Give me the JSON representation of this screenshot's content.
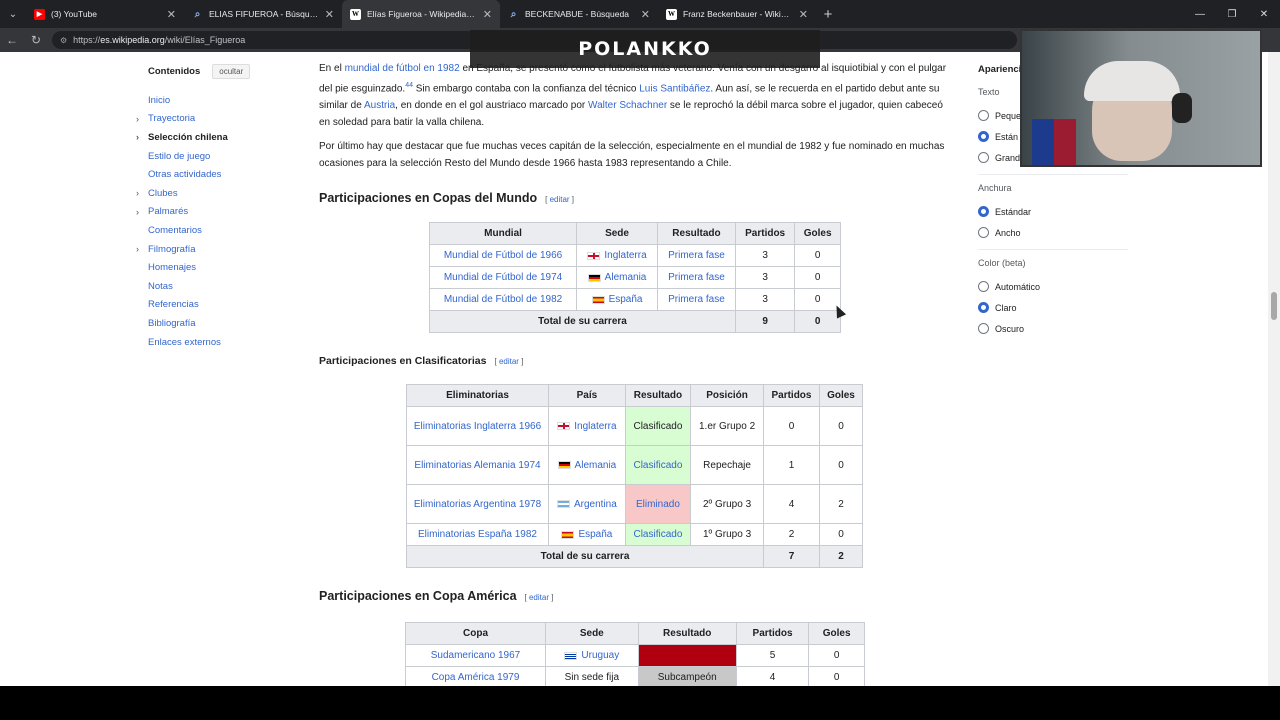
{
  "browser": {
    "tabs": [
      {
        "label": "(3) YouTube",
        "icon": "youtube-icon",
        "active": false
      },
      {
        "label": "ELIAS FIFUEROA - Búsqueda",
        "icon": "search-icon",
        "active": false
      },
      {
        "label": "Elías Figueroa - Wikipedia, la encic",
        "icon": "wikipedia-icon",
        "active": true
      },
      {
        "label": "BECKENABUE - Búsqueda",
        "icon": "search-icon",
        "active": false
      },
      {
        "label": "Franz Beckenbauer - Wikipedia, la",
        "icon": "wikipedia-icon",
        "active": false
      }
    ],
    "url_prefix": "https://",
    "url_domain": "es.wikipedia.org",
    "url_path": "/wiki/Elías_Figueroa"
  },
  "overlay": {
    "logo_text": "POLANKKO"
  },
  "toc": {
    "title": "Contenidos",
    "hide_label": "ocultar",
    "items": [
      {
        "label": "Inicio",
        "chevron": false,
        "active": false
      },
      {
        "label": "Trayectoria",
        "chevron": true,
        "active": false
      },
      {
        "label": "Selección chilena",
        "chevron": true,
        "active": true
      },
      {
        "label": "Estilo de juego",
        "chevron": false,
        "active": false
      },
      {
        "label": "Otras actividades",
        "chevron": false,
        "active": false
      },
      {
        "label": "Clubes",
        "chevron": true,
        "active": false
      },
      {
        "label": "Palmarés",
        "chevron": true,
        "active": false
      },
      {
        "label": "Comentarios",
        "chevron": false,
        "active": false
      },
      {
        "label": "Filmografía",
        "chevron": true,
        "active": false
      },
      {
        "label": "Homenajes",
        "chevron": false,
        "active": false
      },
      {
        "label": "Notas",
        "chevron": false,
        "active": false
      },
      {
        "label": "Referencias",
        "chevron": false,
        "active": false
      },
      {
        "label": "Bibliografía",
        "chevron": false,
        "active": false
      },
      {
        "label": "Enlaces externos",
        "chevron": false,
        "active": false
      }
    ]
  },
  "article": {
    "p1": {
      "a": "En el ",
      "link1": "mundial de fútbol en 1982",
      "b": " en España, se presentó como el futbolista más veterano. Venía con un desgarro al isquiotibial y con el pulgar del pie esguinzado.",
      "sup": "44",
      "c": " Sin embargo contaba con la confianza del técnico ",
      "link2": "Luis Santibáñez",
      "d": ". Aun así, se le recuerda en el partido debut ante su similar de ",
      "link3": "Austria",
      "e": ", en donde en el gol austriaco marcado por ",
      "link4": "Walter Schachner",
      "f": " se le reprochó la débil marca sobre el jugador, quien cabeceó en soledad para batir la valla chilena."
    },
    "p2": "Por último hay que destacar que fue muchas veces capitán de la selección, especialmente en el mundial de 1982 y fue nominado en muchas ocasiones para la selección Resto del Mundo desde 1966 hasta 1983 representando a Chile.",
    "edit_label": "editar",
    "wc": {
      "heading": "Participaciones en Copas del Mundo",
      "headers": [
        "Mundial",
        "Sede",
        "Resultado",
        "Partidos",
        "Goles"
      ],
      "rows": [
        {
          "mundial": "Mundial de Fútbol de 1966",
          "flag": "eng",
          "sede": "Inglaterra",
          "resultado": "Primera fase",
          "partidos": "3",
          "goles": "0"
        },
        {
          "mundial": "Mundial de Fútbol de 1974",
          "flag": "de",
          "sede": "Alemania",
          "resultado": "Primera fase",
          "partidos": "3",
          "goles": "0"
        },
        {
          "mundial": "Mundial de Fútbol de 1982",
          "flag": "es",
          "sede": "España",
          "resultado": "Primera fase",
          "partidos": "3",
          "goles": "0"
        }
      ],
      "total_label": "Total de su carrera",
      "total_partidos": "9",
      "total_goles": "0"
    },
    "qual": {
      "heading": "Participaciones en Clasificatorias",
      "headers": [
        "Eliminatorias",
        "País",
        "Resultado",
        "Posición",
        "Partidos",
        "Goles"
      ],
      "rows": [
        {
          "elim": "Eliminatorias Inglaterra 1966",
          "flag": "eng",
          "pais": "Inglaterra",
          "resultado": "Clasificado",
          "res_class": "res-ok",
          "res_link": false,
          "posicion": "1.er Grupo 2",
          "partidos": "0",
          "goles": "0"
        },
        {
          "elim": "Eliminatorias Alemania 1974",
          "flag": "de",
          "pais": "Alemania",
          "resultado": "Clasificado",
          "res_class": "res-ok",
          "res_link": true,
          "posicion": "Repechaje",
          "partidos": "1",
          "goles": "0"
        },
        {
          "elim": "Eliminatorias Argentina 1978",
          "flag": "ar",
          "pais": "Argentina",
          "resultado": "Eliminado",
          "res_class": "res-bad",
          "res_link": true,
          "posicion": "2º Grupo 3",
          "partidos": "4",
          "goles": "2"
        },
        {
          "elim": "Eliminatorias España 1982",
          "flag": "es",
          "pais": "España",
          "resultado": "Clasificado",
          "res_class": "res-ok",
          "res_link": true,
          "posicion": "1º Grupo 3",
          "partidos": "2",
          "goles": "0"
        }
      ],
      "total_label": "Total de su carrera",
      "total_partidos": "7",
      "total_goles": "2"
    },
    "ca": {
      "heading": "Participaciones en Copa América",
      "headers": [
        "Copa",
        "Sede",
        "Resultado",
        "Partidos",
        "Goles"
      ],
      "rows": [
        {
          "copa": "Sudamericano 1967",
          "flag": "uy",
          "sede": "Uruguay",
          "sede_link": true,
          "resultado": "",
          "res_class": "res-red",
          "partidos": "5",
          "goles": "0"
        },
        {
          "copa": "Copa América 1979",
          "flag": "",
          "sede": "Sin sede fija",
          "sede_link": false,
          "resultado": "Subcampeón",
          "res_class": "res-grey",
          "partidos": "4",
          "goles": "0"
        }
      ]
    }
  },
  "appearance": {
    "title": "Aparienci",
    "text_label": "Texto",
    "text_options": [
      {
        "label": "Peque",
        "checked": false
      },
      {
        "label": "Están",
        "checked": true
      },
      {
        "label": "Grande",
        "checked": false
      }
    ],
    "width_label": "Anchura",
    "width_options": [
      {
        "label": "Estándar",
        "checked": true
      },
      {
        "label": "Ancho",
        "checked": false
      }
    ],
    "color_label": "Color (beta)",
    "color_options": [
      {
        "label": "Automático",
        "checked": false
      },
      {
        "label": "Claro",
        "checked": true
      },
      {
        "label": "Oscuro",
        "checked": false
      }
    ]
  }
}
